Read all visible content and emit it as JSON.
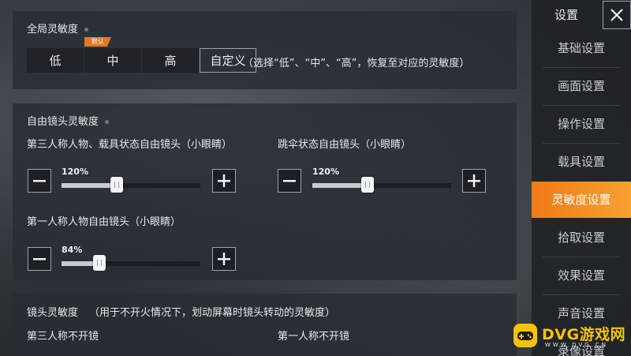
{
  "global_sensitivity": {
    "title": "全局灵敏度",
    "options": [
      "低",
      "中",
      "高",
      "自定义"
    ],
    "selected": "自定义",
    "default_tag": "默认",
    "hint": "（选择“低”、“中”、“高”，恢复至对应的灵敏度）"
  },
  "free_look": {
    "title": "自由镜头灵敏度",
    "third_person": {
      "label": "第三人称人物、载具状态自由镜头（小眼睛）",
      "value_text": "120%",
      "level": 0.4
    },
    "parachute": {
      "label": "跳伞状态自由镜头（小眼睛）",
      "value_text": "120%",
      "level": 0.4
    },
    "first_person": {
      "label": "第一人称人物自由镜头（小眼睛）",
      "value_text": "84%",
      "level": 0.27
    }
  },
  "camera": {
    "title": "镜头灵敏度",
    "hint": "（用于不开火情况下，划动屏幕时镜头转动的灵敏度）",
    "third_person_label": "第三人称不开镜",
    "first_person_label": "第一人称不开镜"
  },
  "sidebar": {
    "title": "设置",
    "items": [
      "基础设置",
      "画面设置",
      "操作设置",
      "载具设置",
      "灵敏度设置",
      "拾取设置",
      "效果设置",
      "声音设置",
      "录像设置"
    ],
    "active": "灵敏度设置",
    "active_color": "#f07a16"
  },
  "watermark": {
    "brand": "DVG游戏网",
    "url": "WWW.DVG.CN"
  }
}
